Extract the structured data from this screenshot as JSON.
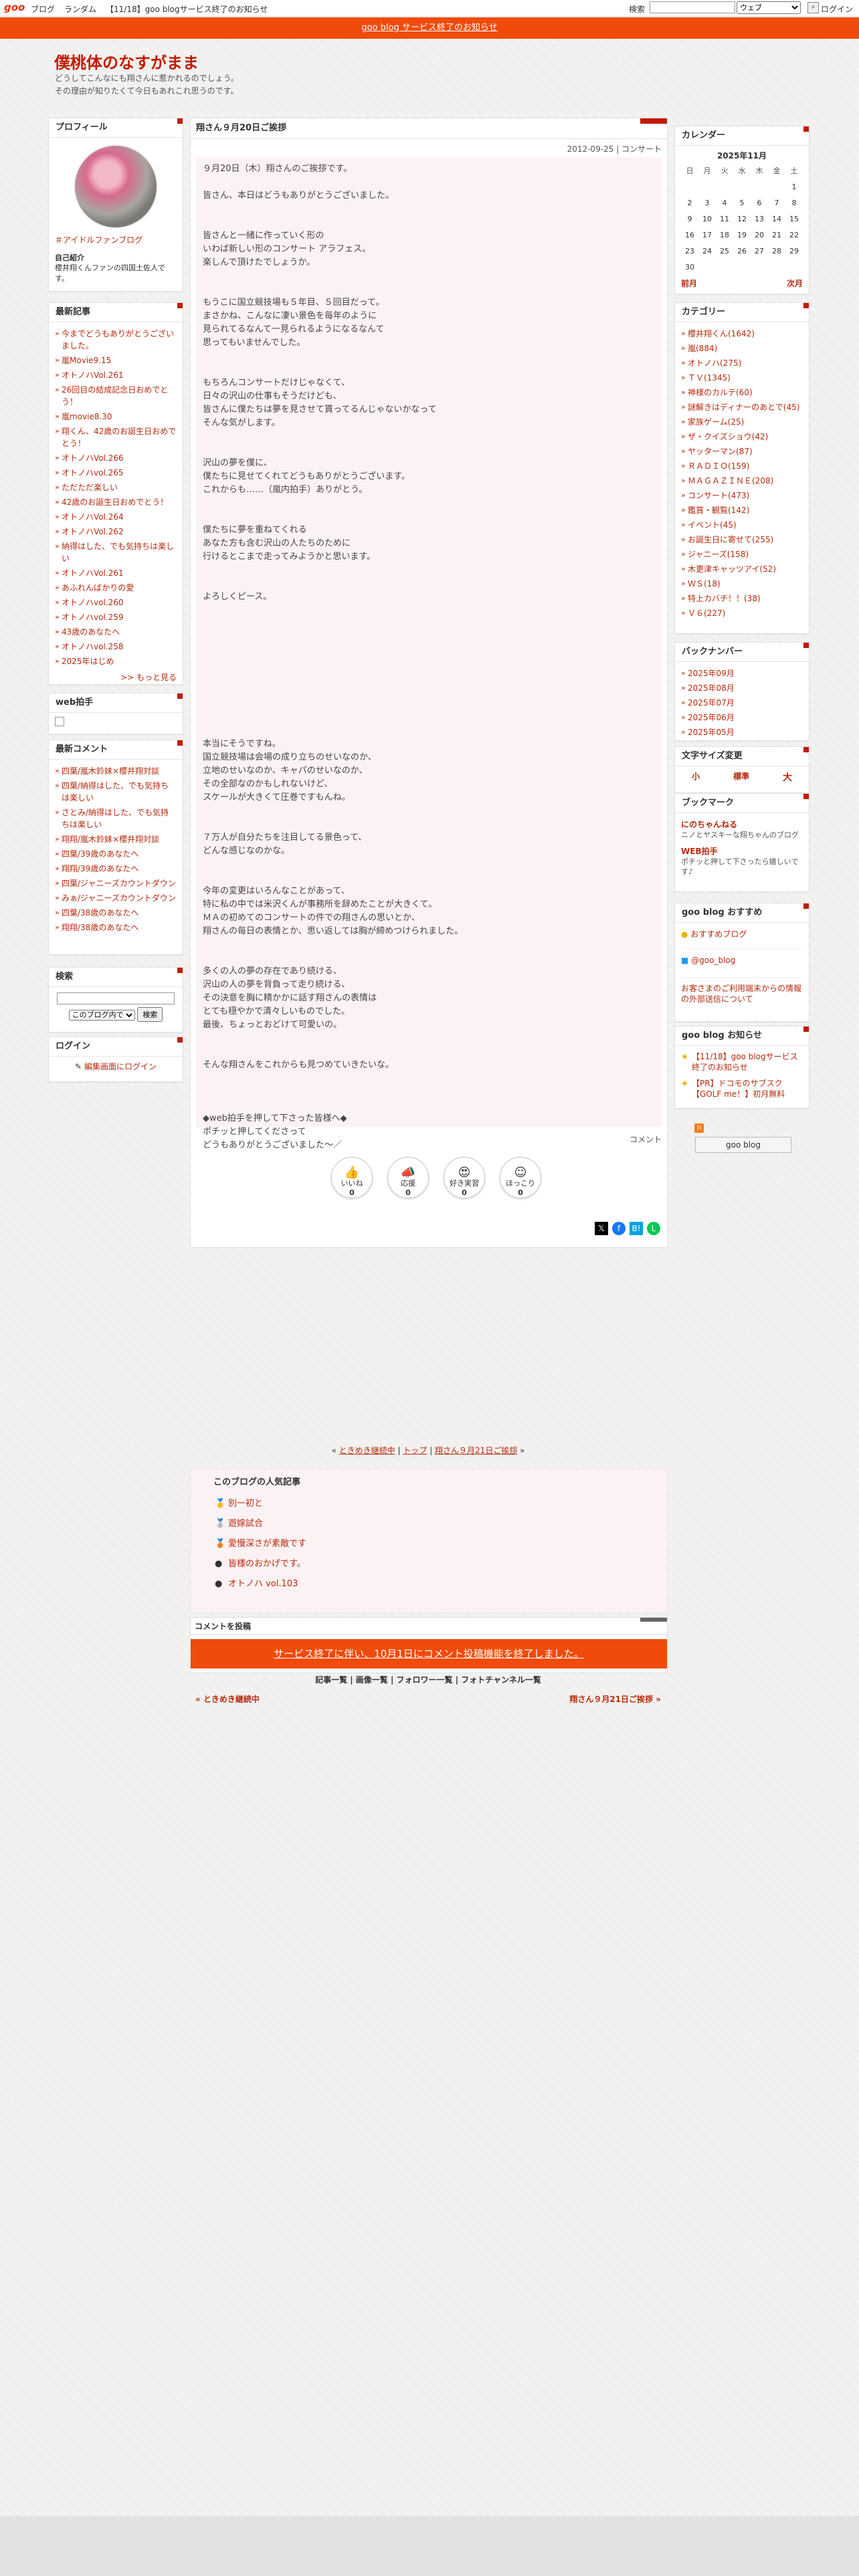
{
  "topbar": {
    "logo": "goo",
    "links": [
      "ブログ",
      "ランダム",
      "【11/18】goo blogサービス終了のお知らせ"
    ],
    "search_label": "検索",
    "search_value": "",
    "search_scope": "ウェブ",
    "login": "ログイン"
  },
  "notice": "goo blog サービス終了のお知らせ",
  "blog": {
    "title": "僕桃体のなすがまま",
    "desc_line1": "どうしてこんなにも翔さんに惹かれるのでしょう。",
    "desc_line2": "その理由が知りたくて今日もあれこれ思うのです。"
  },
  "profile": {
    "heading": "プロフィール",
    "name": "＃アイドルファンブログ",
    "intro_label": "自己紹介",
    "intro": "櫻井翔くんファンの四国土佐人です。"
  },
  "recent": {
    "heading": "最新記事",
    "items": [
      "今までどうもありがとうございました。",
      "嵐Movie9.15",
      "オトノハVol.261",
      "26回目の結成記念日おめでとう！",
      "嵐movie8.30",
      "翔くん、42歳のお誕生日おめでとう！",
      "オトノハVol.266",
      "オトノハvol.265",
      "ただただ楽しい",
      "42歳のお誕生日おめでとう！",
      "オトノハVol.264",
      "オトノハVol.262",
      "納得はした、でも気持ちは楽しい",
      "オトノハVol.261",
      "あふれんばかりの愛",
      "オトノハvol.260",
      "オトノハvol.259",
      "43歳のあなたへ",
      "オトノハvol.258",
      "2025年はじめ"
    ],
    "more": ">> もっと見る"
  },
  "webclap": {
    "heading": "web拍手"
  },
  "comments": {
    "heading": "最新コメント",
    "items": [
      "四葉/嵐木鈴妹×櫻井翔対談",
      "四葉/納得はした、でも気持ちは楽しい",
      "さとみ/納得はした、でも気持ちは楽しい",
      "翔翔/嵐木鈴妹×櫻井翔対談",
      "四葉/39歳のあなたへ",
      "翔翔/39歳のあなたへ",
      "四葉/ジャニーズカウントダウン",
      "みぁ/ジャニーズカウントダウン",
      "四葉/38歳のあなたへ",
      "翔翔/38歳のあなたへ"
    ]
  },
  "search": {
    "heading": "検索",
    "scope": "このブログ内で",
    "button": "検索"
  },
  "login": {
    "heading": "ログイン",
    "link": "編集画面にログイン"
  },
  "entry": {
    "title": "翔さん９月20日ご挨拶",
    "date": "2012-09-25",
    "category": "コンサート",
    "paragraphs": [
      "９月20日（木）翔さんのご挨拶です。",
      "皆さん、本日はどうもありがとうございました。",
      "\n皆さんと一緒に作っていく形の\nいわば新しい形のコンサート アラフェス。\n楽しんで頂けたでしょうか。",
      "\nもうこに国立競技場も５年目、５回目だって。\nまさかね、こんなに凄い景色を毎年のように\n見られてるなんて一見られるようになるなんて\n思ってもいませんでした。",
      "\nもちろんコンサートだけじゃなくて、\n日々の沢山の仕事もそうだけども、\n皆さんに僕たちは夢を見させて貰ってるんじゃないかなって\nそんな気がします。",
      "\n沢山の夢を僕に、\n僕たちに見せてくれてどうもありがとうございます。\nこれからも……（嵐内拍手）ありがとう。",
      "\n僕たちに夢を重ねてくれる\nあなた方も含む沢山の人たちのために\n行けるとこまで走ってみようかと思います。",
      "\nよろしくピース。",
      "\n\n\n\n\n\n\n\n\n本当にそうですね。\n国立競技場は会場の成り立ちのせいなのか、\n立地のせいなのか、キャパのせいなのか、\nその全部なのかもしれないけど、\nスケールが大きくて圧巻ですもんね。",
      "\n７万人が自分たちを注目してる景色って、\nどんな感じなのかな。",
      "\n今年の変更はいろんなことがあって、\n特に私の中では米沢くんが事務所を辞めたことが大きくて。\nＭＡの初めてのコンサートの件での翔さんの思いとか、\n翔さんの毎日の表情とか、思い返しては胸が締めつけられました。",
      "\n多くの人の夢の存在であり続ける、\n沢山の人の夢を背負って走り続ける、\nその決意を胸に精かかに話す翔さんの表情は\nとても穏やかで清々しいものでした。\n最後、ちょっとおどけて可愛いの。",
      "\nそんな翔さんをこれからも見つめていきたいな。",
      "\n\n◆web拍手を押して下さった皆様へ◆\nポチッと押してくださって\nどうもありがとうございました〜／"
    ],
    "comment_label": "コメント",
    "reactions": [
      {
        "label": "いいね",
        "count": "0",
        "icon": "thumbs-up-icon",
        "glyph": "👍"
      },
      {
        "label": "応援",
        "count": "0",
        "icon": "megaphone-icon",
        "glyph": "📣"
      },
      {
        "label": "好き実習",
        "count": "0",
        "icon": "heart-eyes-icon",
        "glyph": "😍"
      },
      {
        "label": "ほっこり",
        "count": "0",
        "icon": "smile-icon",
        "glyph": "☺"
      }
    ]
  },
  "nav": {
    "prev": "ときめき継続中",
    "top": "トップ",
    "next": "翔さん９月21日ご挨拶"
  },
  "popular": {
    "heading": "このブログの人気記事",
    "items": [
      "別一初と",
      "遊嫁試合",
      "愛慢深さが素敵です",
      "皆様のおかげです。",
      "オトノハ vol.103"
    ]
  },
  "comment_post": {
    "heading": "コメントを投稿",
    "button": "サービス終了に伴い、10月1日にコメント投稿機能を終了しました。"
  },
  "bottom_links": "記事一覧 | 画像一覧 | フォロワー一覧 | フォトチャンネル一覧",
  "prevnext": {
    "prev": "« ときめき継続中",
    "next": "翔さん９月21日ご挨拶 »"
  },
  "calendar": {
    "heading": "カレンダー",
    "month": "2025年11月",
    "days": [
      "日",
      "月",
      "火",
      "水",
      "木",
      "金",
      "土"
    ],
    "weeks": [
      [
        "",
        "",
        "",
        "",
        "",
        "",
        "1"
      ],
      [
        "2",
        "3",
        "4",
        "5",
        "6",
        "7",
        "8"
      ],
      [
        "9",
        "10",
        "11",
        "12",
        "13",
        "14",
        "15"
      ],
      [
        "16",
        "17",
        "18",
        "19",
        "20",
        "21",
        "22"
      ],
      [
        "23",
        "24",
        "25",
        "26",
        "27",
        "28",
        "29"
      ],
      [
        "30",
        "",
        "",
        "",
        "",
        "",
        ""
      ]
    ],
    "prev": "前月",
    "next": "次月"
  },
  "categories": {
    "heading": "カテゴリー",
    "items": [
      "櫻井翔くん(1642)",
      "嵐(884)",
      "オトノハ(275)",
      "ＴＶ(1345)",
      "神様のカルテ(60)",
      "謎解きはディナーのあとで(45)",
      "家族ゲーム(25)",
      "ザ・クイズショウ(42)",
      "ヤッターマン(87)",
      "ＲＡＤＩＯ(159)",
      "ＭＡＧＡＺＩＮＥ(208)",
      "コンサート(473)",
      "鑑賞・観覧(142)",
      "イベント(45)",
      "お誕生日に寄せて(255)",
      "ジャニーズ(158)",
      "木更津キャッツアイ(52)",
      "ＷＳ(18)",
      "特上カバチ！！(38)",
      "Ｖ６(227)"
    ]
  },
  "backnumber": {
    "heading": "バックナンバー",
    "items": [
      "2025年09月",
      "2025年08月",
      "2025年07月",
      "2025年06月",
      "2025年05月"
    ]
  },
  "fontsize": {
    "heading": "文字サイズ変更",
    "small": "小",
    "medium": "標準",
    "large": "大"
  },
  "bookmarks": {
    "heading": "ブックマーク",
    "items": [
      {
        "title": "にのちゃんねる",
        "desc": "ニノとヤスキーな翔ちゃんのブログ"
      },
      {
        "title": "WEB拍手",
        "desc": "ポチッと押して下さったら嬉しいです♪"
      }
    ]
  },
  "osusume": {
    "heading": "goo blog おすすめ",
    "link1": "おすすめブログ",
    "link2": "@goo_blog",
    "notice": "お客さまのご利用端末からの情報の外部送信について"
  },
  "oshirase": {
    "heading": "goo blog お知らせ",
    "items": [
      "【11/18】goo blogサービス終了のお知らせ",
      "【PR】ドコモのサブスク【GOLF me！】初月無料"
    ]
  },
  "footer_badge": "goo blog",
  "colors": {
    "accent": "#c21b00",
    "notice_bg": "#f04b0a",
    "post_bg": "#fdf2f3"
  }
}
